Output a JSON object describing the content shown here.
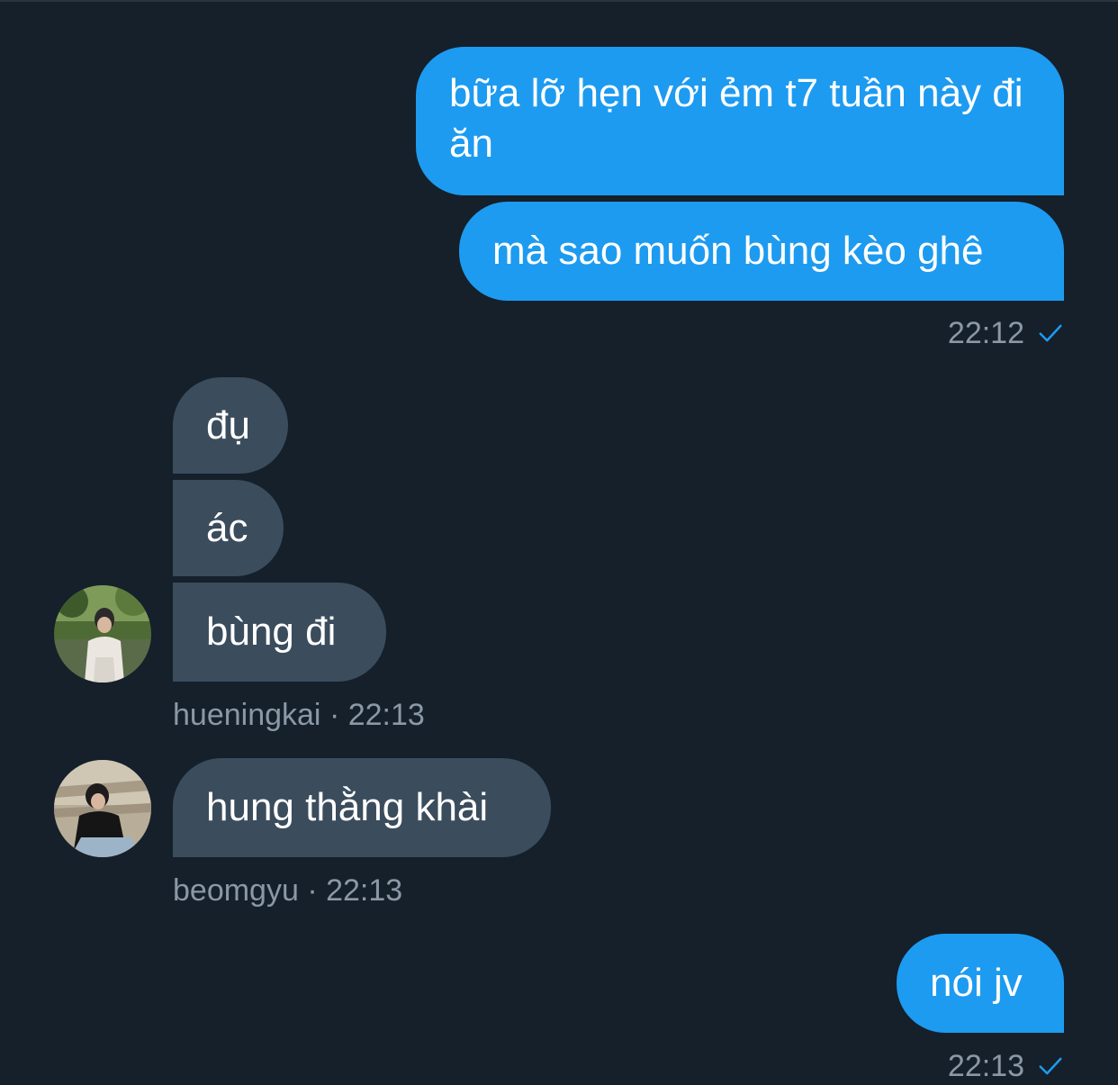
{
  "conversation": {
    "messages": [
      {
        "text": "bữa lỡ hẹn với ẻm t7 tuần này đi ăn"
      },
      {
        "text": "mà sao muốn bùng kèo ghê"
      },
      {
        "text": "đụ"
      },
      {
        "text": "ác"
      },
      {
        "text": "bùng đi"
      },
      {
        "text": "hung thằng khài"
      },
      {
        "text": "nói jv"
      }
    ],
    "meta": {
      "out1_time": "22:12",
      "in1_sender": "hueningkai",
      "in1_sep": "·",
      "in1_time": "22:13",
      "in2_sender": "beomgyu",
      "in2_sep": "·",
      "in2_time": "22:13",
      "out2_time": "22:13"
    }
  },
  "colors": {
    "background": "#15202b",
    "outgoing_bubble": "#1d9bf0",
    "incoming_bubble": "#3b4c5c",
    "meta_text": "#8b98a5",
    "check": "#1d9bf0"
  },
  "icons": {
    "read_receipt": "check-icon"
  }
}
